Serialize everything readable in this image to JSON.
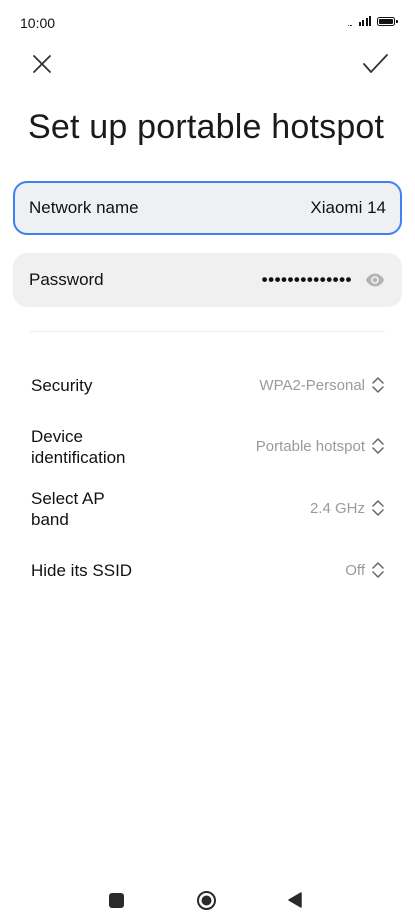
{
  "status_bar": {
    "time": "10:00",
    "icons": [
      "signal-icon",
      "battery-icon"
    ]
  },
  "header": {
    "close_icon": "close-icon",
    "confirm_icon": "check-icon",
    "title": "Set up portable hotspot"
  },
  "network_name": {
    "label": "Network name",
    "value": "Xiaomi 14"
  },
  "password": {
    "label": "Password",
    "value": "••••••••••••••",
    "visibility_icon": "eye-icon"
  },
  "settings": [
    {
      "label": "Security",
      "value": "WPA2-Personal"
    },
    {
      "label": "Device identification",
      "value": "Portable hotspot"
    },
    {
      "label": "Select AP band",
      "value": "2.4 GHz"
    },
    {
      "label": "Hide its SSID",
      "value": "Off"
    }
  ],
  "nav_bar": {
    "items": [
      "recents-button",
      "home-button",
      "back-button"
    ]
  },
  "colors": {
    "accent": "#3b82f6",
    "field_bg": "#f0f0f0",
    "secondary_text": "#9a9a9a"
  }
}
